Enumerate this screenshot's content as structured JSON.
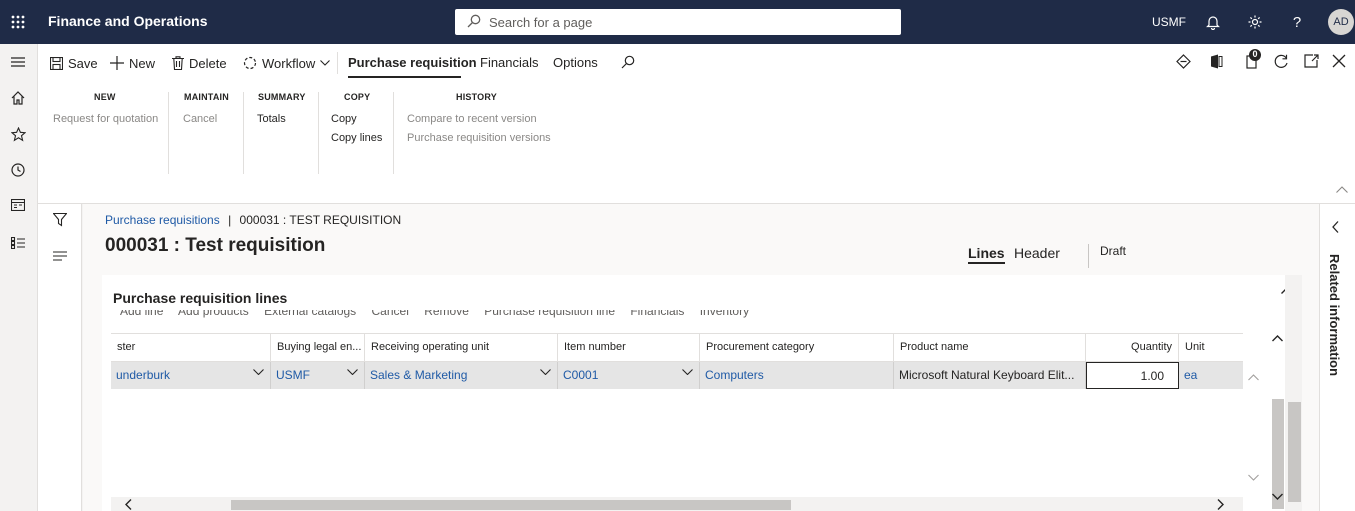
{
  "topbar": {
    "app_title": "Finance and Operations",
    "search_placeholder": "Search for a page",
    "company": "USMF",
    "avatar_initials": "AD",
    "bg_color": "#1f2b47"
  },
  "actionpane": {
    "save_label": "Save",
    "new_label": "New",
    "delete_label": "Delete",
    "workflow_label": "Workflow",
    "tabs": [
      "Purchase requisition",
      "Financials",
      "Options"
    ],
    "notification_count": "0",
    "groups": {
      "new": {
        "header": "NEW",
        "items": [
          "Request for quotation"
        ]
      },
      "maintain": {
        "header": "MAINTAIN",
        "items": [
          "Cancel"
        ]
      },
      "summary": {
        "header": "SUMMARY",
        "items": [
          "Totals"
        ]
      },
      "copy": {
        "header": "COPY",
        "items": [
          "Copy",
          "Copy lines"
        ]
      },
      "history": {
        "header": "HISTORY",
        "items": [
          "Compare to recent version",
          "Purchase requisition versions"
        ]
      }
    }
  },
  "main": {
    "breadcrumb_link": "Purchase requisitions",
    "breadcrumb_sep": "|",
    "breadcrumb_current": "000031 : TEST REQUISITION",
    "page_title": "000031 : Test requisition",
    "view_tabs": [
      "Lines",
      "Header"
    ],
    "status": "Draft"
  },
  "lines": {
    "title": "Purchase requisition lines",
    "toolbar": [
      "Add line",
      "Add products",
      "External catalogs",
      "Cancel",
      "Remove",
      "Purchase requisition line",
      "Financials",
      "Inventory"
    ],
    "columns": [
      "ster",
      "Buying legal en...",
      "Receiving operating unit",
      "Item number",
      "Procurement category",
      "Product name",
      "Quantity",
      "Unit"
    ],
    "row": {
      "requester": "underburk",
      "buying_legal_entity": "USMF",
      "receiving_operating_unit": "Sales & Marketing",
      "item_number": "C0001",
      "procurement_category": "Computers",
      "product_name": "Microsoft Natural Keyboard Elit...",
      "quantity": "1.00",
      "unit": "ea"
    }
  },
  "related_information": "Related information"
}
